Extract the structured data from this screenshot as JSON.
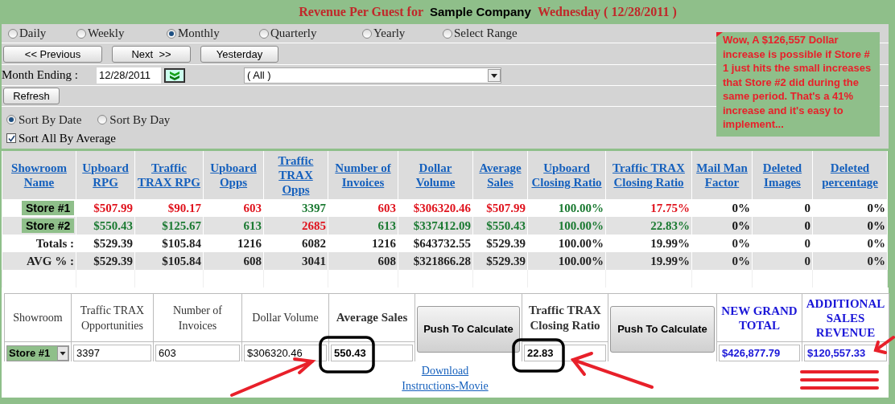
{
  "title": {
    "prefix": "Revenue Per Guest for",
    "company": "Sample Company",
    "date": "Wednesday ( 12/28/2011 )"
  },
  "period_options": [
    {
      "label": "Daily",
      "selected": false
    },
    {
      "label": "Weekly",
      "selected": false
    },
    {
      "label": "Monthly",
      "selected": true
    },
    {
      "label": "Quarterly",
      "selected": false
    },
    {
      "label": "Yearly",
      "selected": false
    },
    {
      "label": "Select Range",
      "selected": false
    }
  ],
  "nav_buttons": [
    "<< Previous",
    "Next  >>",
    "Yesterday"
  ],
  "month_ending": {
    "label": "Month Ending :",
    "value": "12/28/2011"
  },
  "store_filter": {
    "value": "( All )"
  },
  "refresh_button": "Refresh",
  "sort_options": [
    {
      "label": "Sort By Date",
      "selected": true
    },
    {
      "label": "Sort By Day",
      "selected": false
    }
  ],
  "sort_all_by_average": {
    "label": "Sort All By Average",
    "checked": true
  },
  "note": "Wow, A $126,557 Dollar increase is possible if Store # 1 just hits the small increases that Store #2 did during the same period. That's a 41% increase and it's easy to implement...",
  "table": {
    "columns": [
      "Showroom Name",
      "Upboard RPG",
      "Traffic TRAX RPG",
      "Upboard Opps",
      "Traffic TRAX Opps",
      "Number of Invoices",
      "Dollar Volume",
      "Average Sales",
      "Upboard Closing Ratio",
      "Traffic TRAX Closing Ratio",
      "Mail Man Factor",
      "Deleted Images",
      "Deleted percentage"
    ],
    "rows": [
      {
        "kind": "store",
        "cells": [
          {
            "text": "Store #1"
          },
          {
            "text": "$507.99",
            "color": "#e0141e"
          },
          {
            "text": "$90.17",
            "color": "#e0141e"
          },
          {
            "text": "603",
            "color": "#e0141e"
          },
          {
            "text": "3397",
            "color": "#1b7a32"
          },
          {
            "text": "603",
            "color": "#e0141e"
          },
          {
            "text": "$306320.46",
            "color": "#e0141e"
          },
          {
            "text": "$507.99",
            "color": "#e0141e"
          },
          {
            "text": "100.00%",
            "color": "#1b7a32"
          },
          {
            "text": "17.75%",
            "color": "#e0141e"
          },
          {
            "text": "0%",
            "color": "#111111"
          },
          {
            "text": "0",
            "color": "#111111"
          },
          {
            "text": "0%",
            "color": "#111111"
          }
        ]
      },
      {
        "kind": "store",
        "cells": [
          {
            "text": "Store #2"
          },
          {
            "text": "$550.43",
            "color": "#1b7a32"
          },
          {
            "text": "$125.67",
            "color": "#1b7a32"
          },
          {
            "text": "613",
            "color": "#1b7a32"
          },
          {
            "text": "2685",
            "color": "#e0141e"
          },
          {
            "text": "613",
            "color": "#1b7a32"
          },
          {
            "text": "$337412.09",
            "color": "#1b7a32"
          },
          {
            "text": "$550.43",
            "color": "#1b7a32"
          },
          {
            "text": "100.00%",
            "color": "#1b7a32"
          },
          {
            "text": "22.83%",
            "color": "#1b7a32"
          },
          {
            "text": "0%",
            "color": "#111111"
          },
          {
            "text": "0",
            "color": "#111111"
          },
          {
            "text": "0%",
            "color": "#111111"
          }
        ]
      },
      {
        "kind": "summary",
        "cells": [
          {
            "text": "Totals :",
            "color": "#222222"
          },
          {
            "text": "$529.39",
            "color": "#222222"
          },
          {
            "text": "$105.84",
            "color": "#222222"
          },
          {
            "text": "1216",
            "color": "#222222"
          },
          {
            "text": "6082",
            "color": "#222222"
          },
          {
            "text": "1216",
            "color": "#222222"
          },
          {
            "text": "$643732.55",
            "color": "#222222"
          },
          {
            "text": "$529.39",
            "color": "#222222"
          },
          {
            "text": "100.00%",
            "color": "#222222"
          },
          {
            "text": "19.99%",
            "color": "#222222"
          },
          {
            "text": "0%",
            "color": "#222222"
          },
          {
            "text": "0",
            "color": "#222222"
          },
          {
            "text": "0%",
            "color": "#222222"
          }
        ]
      },
      {
        "kind": "summary",
        "cells": [
          {
            "text": "AVG % :",
            "color": "#222222"
          },
          {
            "text": "$529.39",
            "color": "#222222"
          },
          {
            "text": "$105.84",
            "color": "#222222"
          },
          {
            "text": "608",
            "color": "#222222"
          },
          {
            "text": "3041",
            "color": "#222222"
          },
          {
            "text": "608",
            "color": "#222222"
          },
          {
            "text": "$321866.28",
            "color": "#222222"
          },
          {
            "text": "$529.39",
            "color": "#222222"
          },
          {
            "text": "100.00%",
            "color": "#222222"
          },
          {
            "text": "19.99%",
            "color": "#222222"
          },
          {
            "text": "0%",
            "color": "#222222"
          },
          {
            "text": "0",
            "color": "#222222"
          },
          {
            "text": "0%",
            "color": "#222222"
          }
        ]
      }
    ]
  },
  "calculator": [
    {
      "kind": "select",
      "label": "Showroom",
      "value": "Store #1",
      "bold": false,
      "color": "#333333"
    },
    {
      "kind": "field",
      "label": "Traffic TRAX Opportunities",
      "value": "3397",
      "bold": false,
      "color": "#333333"
    },
    {
      "kind": "field",
      "label": "Number of Invoices",
      "value": "603",
      "bold": false,
      "color": "#333333"
    },
    {
      "kind": "field",
      "label": "Dollar Volume",
      "value": "$306320.46",
      "bold": false,
      "color": "#333333"
    },
    {
      "kind": "field",
      "label": "Average Sales",
      "value": "550.43",
      "bold": true,
      "color": "#333333"
    },
    {
      "kind": "button",
      "label": "Push To Calculate"
    },
    {
      "kind": "field",
      "label": "Traffic TRAX Closing Ratio",
      "value": "22.83",
      "bold": true,
      "color": "#333333"
    },
    {
      "kind": "button",
      "label": "Push To Calculate"
    },
    {
      "kind": "field",
      "label": "NEW GRAND TOTAL",
      "value": "$426,877.79",
      "bold": true,
      "color": "#1a16d8"
    },
    {
      "kind": "field",
      "label": "ADDITIONAL SALES REVENUE",
      "value": "$120,557.33",
      "bold": true,
      "color": "#1a16d8"
    }
  ],
  "links": [
    "Download",
    "Instructions-Movie"
  ]
}
